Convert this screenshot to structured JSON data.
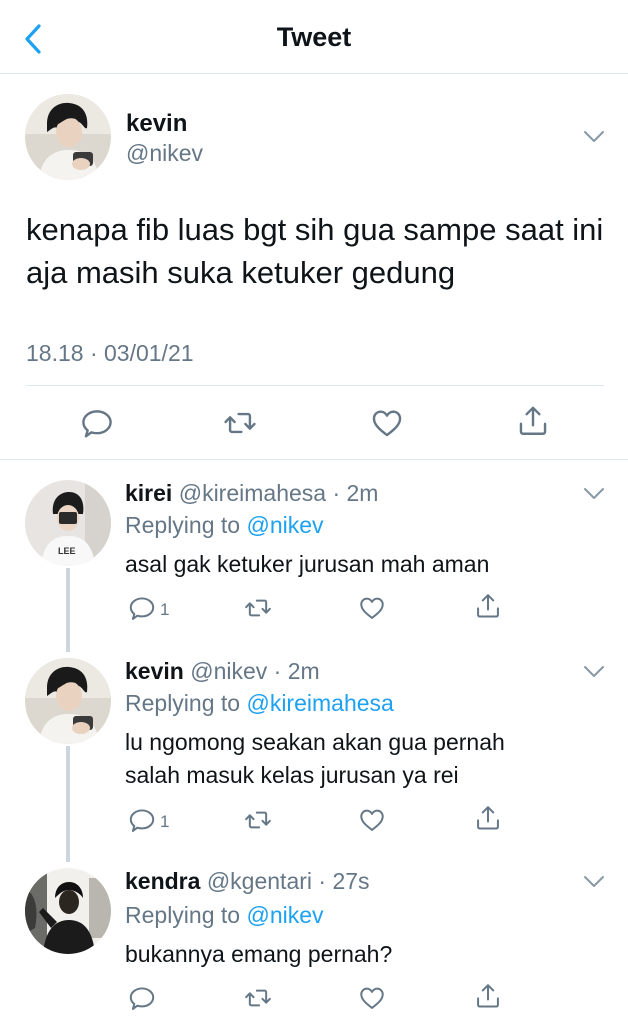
{
  "header": {
    "title": "Tweet",
    "back_icon": "chevron-left-icon"
  },
  "colors": {
    "accent": "#1da1f2",
    "text": "#0f1419",
    "muted": "#657786",
    "border": "#e1e8ed"
  },
  "main_tweet": {
    "name": "kevin",
    "handle": "@nikev",
    "text": "kenapa fib luas bgt sih gua sampe saat ini aja masih suka ketuker gedung",
    "timestamp": "18.18 · 03/01/21"
  },
  "replies": [
    {
      "name": "kirei",
      "handle": "@kireimahesa · 2m",
      "replying_label": "Replying to",
      "replying_to": "@nikev",
      "text": "asal gak ketuker jurusan mah aman",
      "reply_count": "1"
    },
    {
      "name": "kevin",
      "handle": "@nikev · 2m",
      "replying_label": "Replying to",
      "replying_to": "@kireimahesa",
      "text": "lu ngomong seakan akan gua pernah salah masuk kelas jurusan ya rei",
      "reply_count": "1"
    },
    {
      "name": "kendra",
      "handle": "@kgentari · 27s",
      "replying_label": "Replying to",
      "replying_to": "@nikev",
      "text": "bukannya emang pernah?",
      "reply_count": ""
    }
  ]
}
